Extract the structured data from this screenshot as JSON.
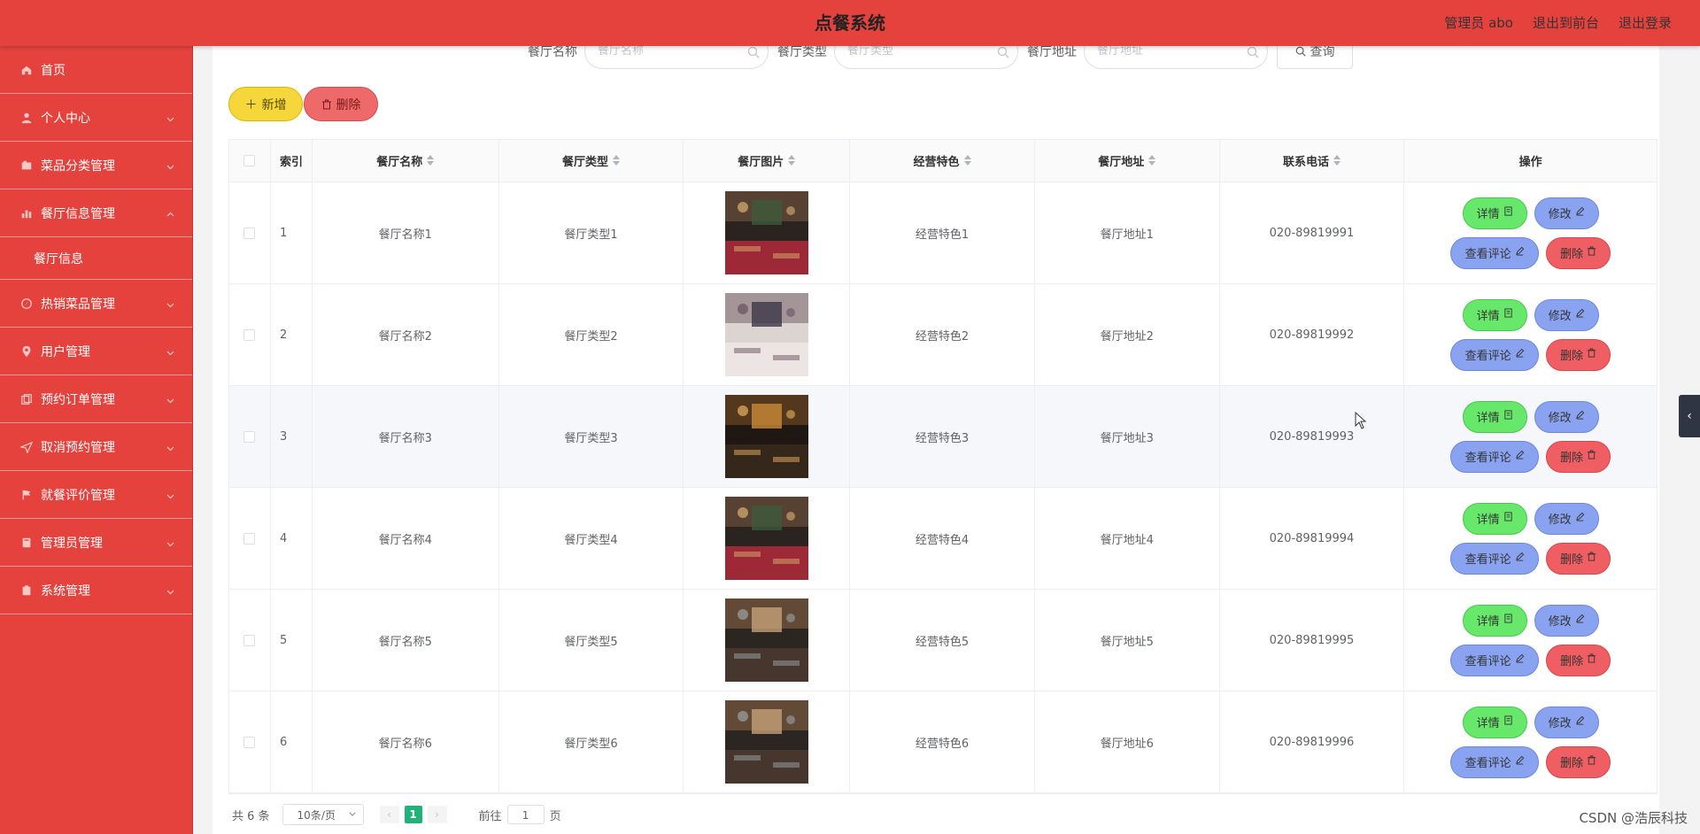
{
  "header": {
    "title": "点餐系统",
    "links": [
      "管理员 abo",
      "退出到前台",
      "退出登录"
    ]
  },
  "sidebar": {
    "items": [
      {
        "label": "首页",
        "icon": "home-icon"
      },
      {
        "label": "个人中心",
        "icon": "user-icon"
      },
      {
        "label": "菜品分类管理",
        "icon": "table-icon"
      },
      {
        "label": "餐厅信息管理",
        "icon": "chart-icon",
        "expanded": true,
        "children": [
          "餐厅信息"
        ]
      },
      {
        "label": "热销菜品管理",
        "icon": "compass-icon"
      },
      {
        "label": "用户管理",
        "icon": "location-icon"
      },
      {
        "label": "预约订单管理",
        "icon": "copy-icon"
      },
      {
        "label": "取消预约管理",
        "icon": "send-icon"
      },
      {
        "label": "就餐评价管理",
        "icon": "flag-icon"
      },
      {
        "label": "管理员管理",
        "icon": "book-icon"
      },
      {
        "label": "系统管理",
        "icon": "clipboard-icon"
      }
    ]
  },
  "search": {
    "name_label": "餐厅名称",
    "name_placeholder": "餐厅名称",
    "type_label": "餐厅类型",
    "type_placeholder": "餐厅类型",
    "addr_label": "餐厅地址",
    "addr_placeholder": "餐厅地址",
    "query_label": "查询"
  },
  "toolbar": {
    "add_label": "新增",
    "delete_label": "删除"
  },
  "table": {
    "headers": [
      "索引",
      "餐厅名称",
      "餐厅类型",
      "餐厅图片",
      "经营特色",
      "餐厅地址",
      "联系电话",
      "操作"
    ],
    "rows": [
      {
        "index": "1",
        "name": "餐厅名称1",
        "type": "餐厅类型1",
        "feature": "经营特色1",
        "address": "餐厅地址1",
        "phone": "020-89819991",
        "img": "dark"
      },
      {
        "index": "2",
        "name": "餐厅名称2",
        "type": "餐厅类型2",
        "feature": "经营特色2",
        "address": "餐厅地址2",
        "phone": "020-89819992",
        "img": "bright"
      },
      {
        "index": "3",
        "name": "餐厅名称3",
        "type": "餐厅类型3",
        "feature": "经营特色3",
        "address": "餐厅地址3",
        "phone": "020-89819993",
        "img": "warm"
      },
      {
        "index": "4",
        "name": "餐厅名称4",
        "type": "餐厅类型4",
        "feature": "经营特色4",
        "address": "餐厅地址4",
        "phone": "020-89819994",
        "img": "dark"
      },
      {
        "index": "5",
        "name": "餐厅名称5",
        "type": "餐厅类型5",
        "feature": "经营特色5",
        "address": "餐厅地址5",
        "phone": "020-89819995",
        "img": "wood"
      },
      {
        "index": "6",
        "name": "餐厅名称6",
        "type": "餐厅类型6",
        "feature": "经营特色6",
        "address": "餐厅地址6",
        "phone": "020-89819996",
        "img": "wood"
      }
    ],
    "actions": {
      "detail": "详情",
      "edit": "修改",
      "review": "查看评论",
      "remove": "删除"
    },
    "highlighted_row": 3
  },
  "pagination": {
    "total": "共 6 条",
    "page_size": "10条/页",
    "current_page": "1",
    "goto_prefix": "前往",
    "goto_value": "1",
    "goto_suffix": "页"
  },
  "watermark": "CSDN @浩辰科技",
  "colors": {
    "primary": "#e5423e",
    "detail": "#67e86b",
    "edit": "#8aa3f0",
    "remove": "#ef5e62",
    "add": "#f5d63b"
  }
}
